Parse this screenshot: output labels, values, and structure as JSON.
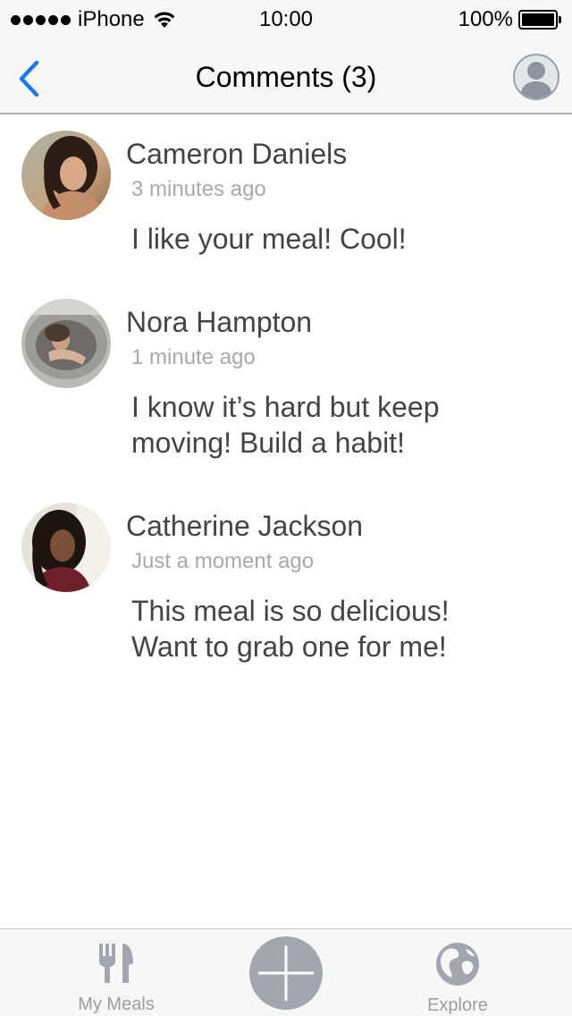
{
  "status_bar": {
    "carrier": "iPhone",
    "time": "10:00",
    "battery": "100%"
  },
  "nav": {
    "title": "Comments (3)"
  },
  "comments": [
    {
      "author": "Cameron Daniels",
      "time": "3 minutes ago",
      "text": "I like your meal! Cool!"
    },
    {
      "author": "Nora Hampton",
      "time": "1 minute ago",
      "text": "I know it’s hard but keep moving! Build a habit!"
    },
    {
      "author": "Catherine Jackson",
      "time": "Just a moment ago",
      "text": "This meal is so delicious! Want to grab one for me!"
    }
  ],
  "tab_bar": {
    "my_meals_label": "My Meals",
    "explore_label": "Explore"
  },
  "icons": {
    "back": "chevron-left-icon",
    "profile": "user-silhouette-icon",
    "my_meals": "fork-knife-icon",
    "add": "plus-icon",
    "explore": "globe-icon"
  },
  "colors": {
    "accent": "#1a7cf5",
    "tab_icon": "#a3a6ae",
    "secondary_text": "#a8a8ae"
  }
}
